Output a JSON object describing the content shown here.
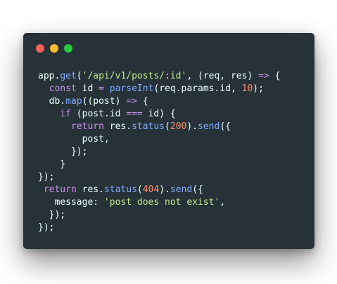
{
  "colors": {
    "background": "#263238",
    "dot_red": "#ff5f56",
    "dot_yellow": "#ffbd2e",
    "dot_green": "#27c93f",
    "plain": "#eeffff",
    "function": "#82aaff",
    "keyword": "#c792ea",
    "string": "#c3e88d",
    "number": "#f78c6c",
    "property": "#eeffff",
    "punctuation": "#89ddff"
  },
  "window_controls": [
    {
      "name": "close-button",
      "icon": "red-circle"
    },
    {
      "name": "minimize-button",
      "icon": "yellow-circle"
    },
    {
      "name": "zoom-button",
      "icon": "green-circle"
    }
  ],
  "code_lines": [
    [
      [
        "app",
        "plain"
      ],
      [
        ".",
        "plain"
      ],
      [
        "get",
        "function"
      ],
      [
        "(",
        "plain"
      ],
      [
        "'/api/v1/posts/:id'",
        "string"
      ],
      [
        ", (req, res) ",
        "plain"
      ],
      [
        "=>",
        "keyword"
      ],
      [
        " {",
        "plain"
      ]
    ],
    [
      [
        "  ",
        "plain"
      ],
      [
        "const",
        "keyword"
      ],
      [
        " id ",
        "plain"
      ],
      [
        "=",
        "keyword"
      ],
      [
        " ",
        "plain"
      ],
      [
        "parseInt",
        "function"
      ],
      [
        "(req.params.id, ",
        "plain"
      ],
      [
        "10",
        "number"
      ],
      [
        ");",
        "plain"
      ]
    ],
    [
      [
        "  db.",
        "plain"
      ],
      [
        "map",
        "function"
      ],
      [
        "((post) ",
        "plain"
      ],
      [
        "=>",
        "keyword"
      ],
      [
        " {",
        "plain"
      ]
    ],
    [
      [
        "    ",
        "plain"
      ],
      [
        "if",
        "keyword"
      ],
      [
        " (post.id ",
        "plain"
      ],
      [
        "===",
        "keyword"
      ],
      [
        " id) {",
        "plain"
      ]
    ],
    [
      [
        "      ",
        "plain"
      ],
      [
        "return",
        "keyword"
      ],
      [
        " res.",
        "plain"
      ],
      [
        "status",
        "function"
      ],
      [
        "(",
        "plain"
      ],
      [
        "200",
        "number"
      ],
      [
        ").",
        "plain"
      ],
      [
        "send",
        "function"
      ],
      [
        "({",
        "plain"
      ]
    ],
    [
      [
        "        post,",
        "plain"
      ]
    ],
    [
      [
        "      });",
        "plain"
      ]
    ],
    [
      [
        "    }",
        "plain"
      ]
    ],
    [
      [
        "});",
        "plain"
      ]
    ],
    [
      [
        " ",
        "plain"
      ],
      [
        "return",
        "keyword"
      ],
      [
        " res.",
        "plain"
      ],
      [
        "status",
        "function"
      ],
      [
        "(",
        "plain"
      ],
      [
        "404",
        "number"
      ],
      [
        ").",
        "plain"
      ],
      [
        "send",
        "function"
      ],
      [
        "({",
        "plain"
      ]
    ],
    [
      [
        "   message: ",
        "plain"
      ],
      [
        "'post does not exist'",
        "string"
      ],
      [
        ",",
        "plain"
      ]
    ],
    [
      [
        "  });",
        "plain"
      ]
    ],
    [
      [
        "});",
        "plain"
      ]
    ]
  ]
}
